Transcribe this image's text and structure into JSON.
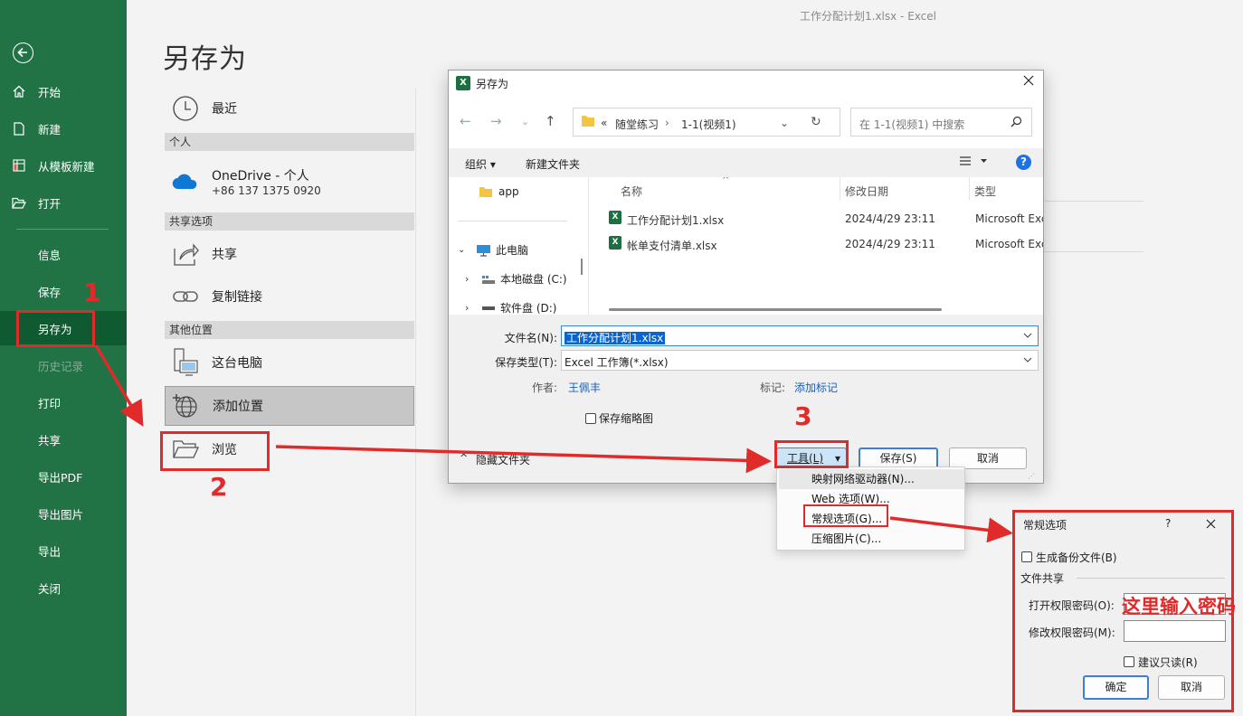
{
  "window": {
    "title": "工作分配计划1.xlsx  -  Excel"
  },
  "sidebar": {
    "items": [
      {
        "label": "开始",
        "icon": "home-icon"
      },
      {
        "label": "新建",
        "icon": "new-file-icon"
      },
      {
        "label": "从模板新建",
        "icon": "template-icon"
      },
      {
        "label": "打开",
        "icon": "open-folder-icon"
      },
      {
        "label": "信息"
      },
      {
        "label": "保存"
      },
      {
        "label": "另存为",
        "selected": true
      },
      {
        "label": "历史记录",
        "disabled": true
      },
      {
        "label": "打印"
      },
      {
        "label": "共享"
      },
      {
        "label": "导出PDF"
      },
      {
        "label": "导出图片"
      },
      {
        "label": "导出"
      },
      {
        "label": "关闭"
      }
    ]
  },
  "backstage": {
    "title": "另存为",
    "recent": "最近",
    "personal_header": "个人",
    "onedrive": {
      "name": "OneDrive - 个人",
      "account": "+86 137 1375 0920"
    },
    "shared_header": "共享选项",
    "share": "共享",
    "copy_link": "复制链接",
    "other_header": "其他位置",
    "this_pc": "这台电脑",
    "add_location": "添加位置",
    "browse": "浏览"
  },
  "dialog": {
    "title": "另存为",
    "breadcrumb": {
      "prefix": "«",
      "parent": "随堂练习",
      "current": "1-1(视频1)"
    },
    "search_placeholder": "在 1-1(视频1) 中搜索",
    "toolbar": {
      "organize": "组织 ▾",
      "new_folder": "新建文件夹"
    },
    "tree": {
      "app": "app",
      "this_pc": "此电脑",
      "c_drive": "本地磁盘 (C:)",
      "d_drive": "软件盘 (D:)"
    },
    "columns": {
      "name": "名称",
      "modified": "修改日期",
      "type": "类型"
    },
    "files": [
      {
        "name": "工作分配计划1.xlsx",
        "modified": "2024/4/29 23:11",
        "type": "Microsoft Excel"
      },
      {
        "name": "帐单支付清单.xlsx",
        "modified": "2024/4/29 23:11",
        "type": "Microsoft Excel"
      }
    ],
    "filename_label": "文件名(N):",
    "filename": "工作分配计划1.xlsx",
    "filetype_label": "保存类型(T):",
    "filetype": "Excel 工作簿(*.xlsx)",
    "author_label": "作者:",
    "author": "王佩丰",
    "tags_label": "标记:",
    "tags_link": "添加标记",
    "thumbnail": "保存缩略图",
    "hide_folders": "隐藏文件夹",
    "tools": "工具(L)",
    "save": "保存(S)",
    "cancel": "取消"
  },
  "tools_menu": {
    "items": [
      "映射网络驱动器(N)...",
      "Web 选项(W)...",
      "常规选项(G)...",
      "压缩图片(C)..."
    ]
  },
  "general_options": {
    "title": "常规选项",
    "help": "?",
    "backup": "生成备份文件(B)",
    "file_sharing": "文件共享",
    "open_pwd_label": "打开权限密码(O):",
    "modify_pwd_label": "修改权限密码(M):",
    "readonly": "建议只读(R)",
    "ok": "确定",
    "cancel": "取消"
  },
  "annotations": {
    "step1": "1",
    "step2": "2",
    "step3": "3",
    "password_note": "这里输入密码",
    "color": "#e12b2b"
  },
  "colors": {
    "brand": "#217346",
    "selected": "#0f5a30",
    "link": "#1a5fb4"
  }
}
